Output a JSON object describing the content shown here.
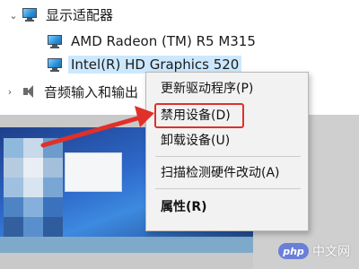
{
  "tree": {
    "category_display_adapters": "显示适配器",
    "device_amd": "AMD Radeon (TM) R5 M315",
    "device_intel": "Intel(R) HD Graphics 520",
    "category_audio": "音频输入和输出"
  },
  "context_menu": {
    "items": [
      "更新驱动程序(P)",
      "禁用设备(D)",
      "卸载设备(U)",
      "扫描检测硬件改动(A)",
      "属性(R)"
    ],
    "highlighted_index": 1
  },
  "watermark": {
    "logo": "php",
    "text": "中文网"
  },
  "colors": {
    "highlight": "#e0302a",
    "selection": "#cce8ff",
    "menu_bg": "#f2f2f2"
  }
}
